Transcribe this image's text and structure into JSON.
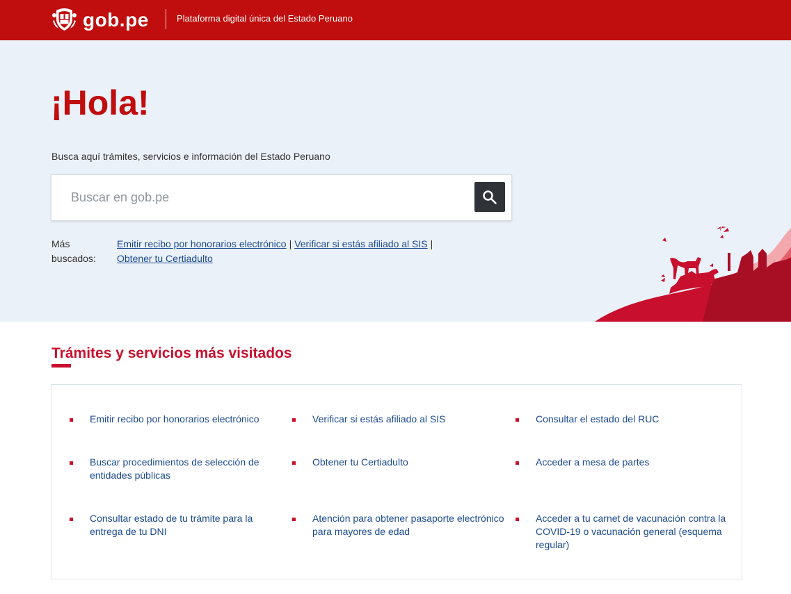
{
  "header": {
    "logo_text": "gob.pe",
    "tagline": "Plataforma digital única del Estado Peruano",
    "bg_color": "#c00d0d"
  },
  "hero": {
    "title": "¡Hola!",
    "subtitle": "Busca aquí trámites, servicios e información del Estado Peruano",
    "search": {
      "placeholder": "Buscar en gob.pe",
      "value": "",
      "button_icon": "search-icon"
    },
    "most_searched": {
      "label": "Más buscados:",
      "links": [
        "Emitir recibo por honorarios electrónico",
        "Verificar si estás afiliado al SIS",
        "Obtener tu Certiadulto"
      ],
      "separator": "|"
    }
  },
  "services_section": {
    "title": "Trámites y servicios más visitados",
    "accent_color": "#c8102e",
    "items": [
      "Emitir recibo por honorarios electrónico",
      "Verificar si estás afiliado al SIS",
      "Consultar el estado del RUC",
      "Buscar procedimientos de selección de entidades públicas",
      "Obtener tu Certiadulto",
      "Acceder a mesa de partes",
      "Consultar estado de tu trámite para la entrega de tu DNI",
      "Atención para obtener pasaporte electrónico para mayores de edad",
      "Acceder a tu carnet de vacunación contra la COVID-19 o vacunación general (esquema regular)"
    ]
  }
}
